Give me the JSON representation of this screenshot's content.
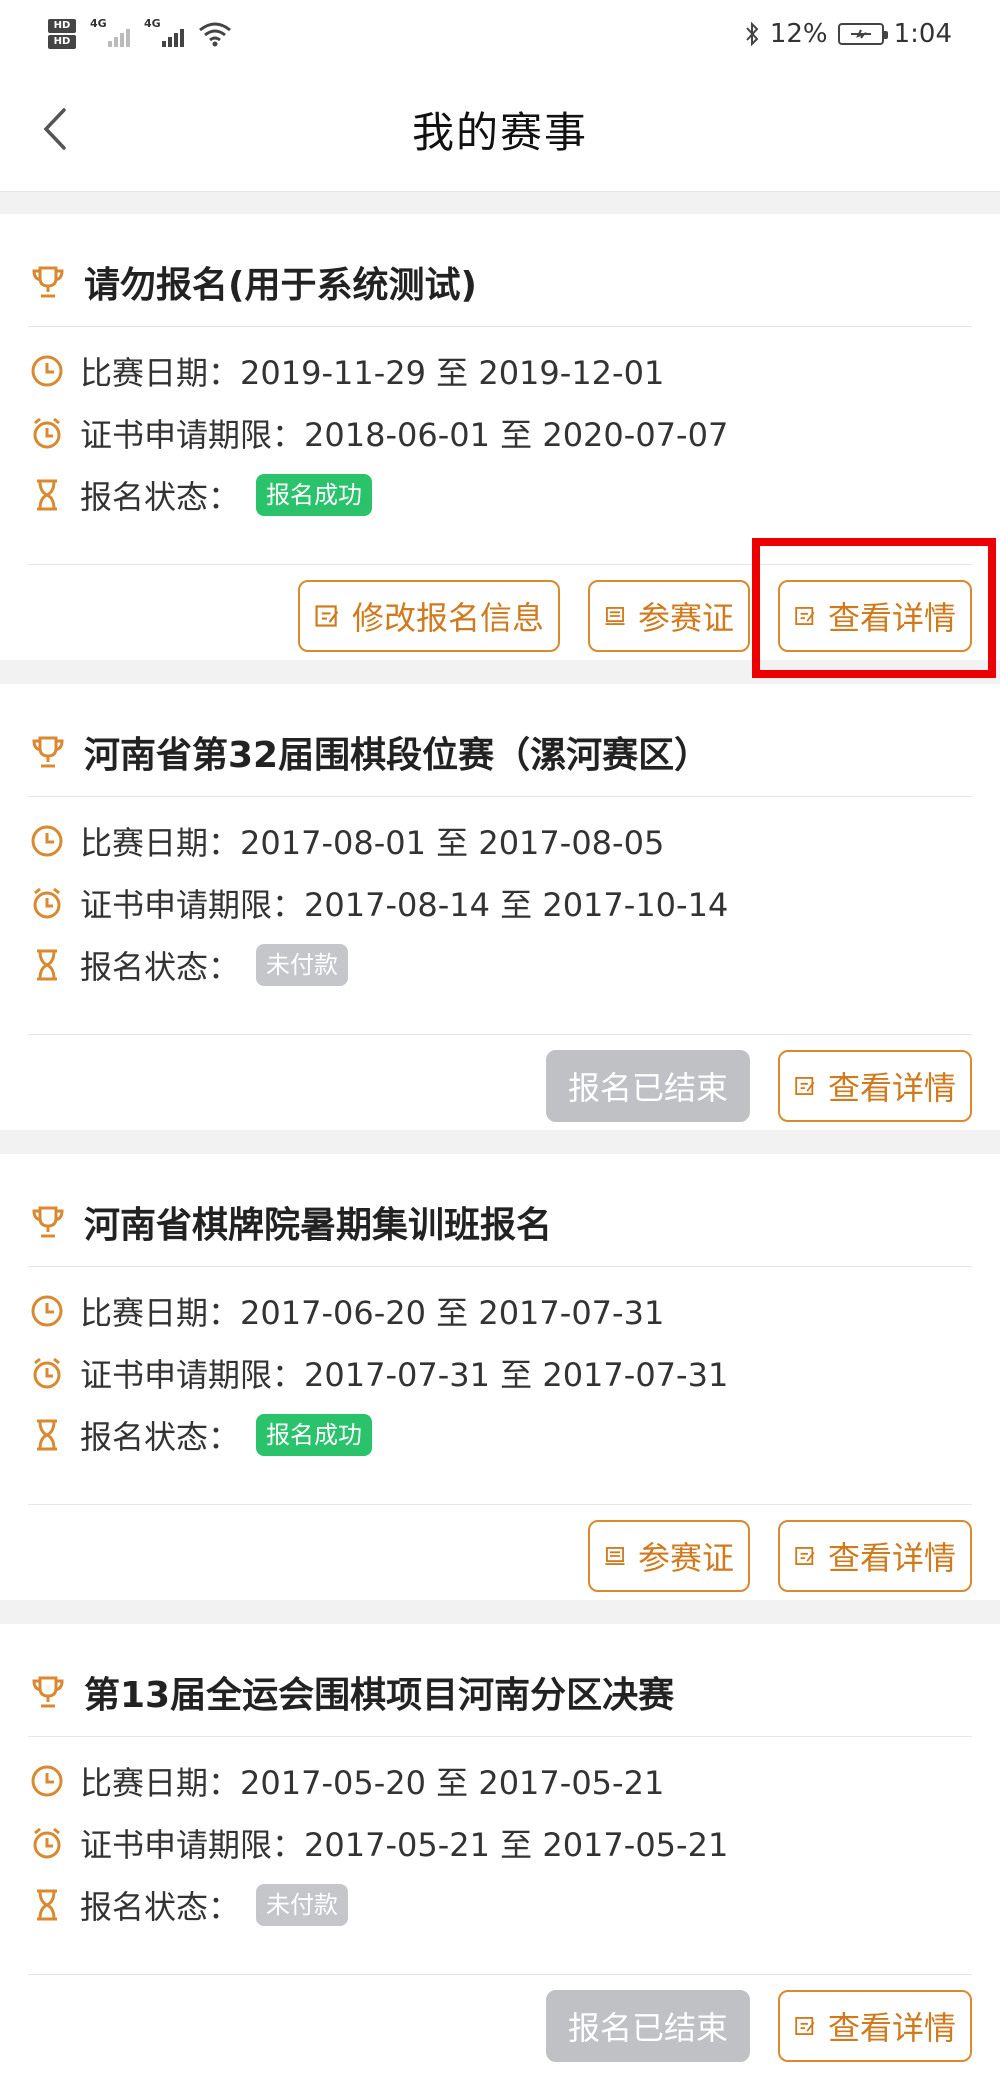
{
  "status_bar": {
    "hd1": "HD",
    "hd2": "HD",
    "net1": "4G",
    "net2": "4G",
    "battery_percent": "12%",
    "time": "1:04"
  },
  "nav": {
    "title": "我的赛事"
  },
  "events": [
    {
      "title": "请勿报名(用于系统测试)",
      "match_date_label": "比赛日期：",
      "match_date_value": "2019-11-29 至 2019-12-01",
      "cert_label": "证书申请期限：",
      "cert_value": "2018-06-01 至 2020-07-07",
      "status_label": "报名状态：",
      "status_value": "报名成功",
      "status_color": "#2ac36c",
      "buttons": [
        "修改报名信息",
        "参赛证",
        "查看详情"
      ]
    },
    {
      "title": "河南省第32届围棋段位赛（漯河赛区）",
      "match_date_label": "比赛日期：",
      "match_date_value": "2017-08-01 至 2017-08-05",
      "cert_label": "证书申请期限：",
      "cert_value": "2017-08-14 至 2017-10-14",
      "status_label": "报名状态：",
      "status_value": "未付款",
      "status_color": "#c4c6ca",
      "buttons": [
        "报名已结束",
        "查看详情"
      ]
    },
    {
      "title": "河南省棋牌院暑期集训班报名",
      "match_date_label": "比赛日期：",
      "match_date_value": "2017-06-20 至 2017-07-31",
      "cert_label": "证书申请期限：",
      "cert_value": "2017-07-31 至 2017-07-31",
      "status_label": "报名状态：",
      "status_value": "报名成功",
      "status_color": "#2ac36c",
      "buttons": [
        "参赛证",
        "查看详情"
      ]
    },
    {
      "title": "第13届全运会围棋项目河南分区决赛",
      "match_date_label": "比赛日期：",
      "match_date_value": "2017-05-20 至 2017-05-21",
      "cert_label": "证书申请期限：",
      "cert_value": "2017-05-21 至 2017-05-21",
      "status_label": "报名状态：",
      "status_value": "未付款",
      "status_color": "#c4c6ca",
      "buttons": [
        "报名已结束",
        "查看详情"
      ]
    }
  ],
  "colors": {
    "accent": "#d9892f",
    "highlight": "#ee0000"
  }
}
